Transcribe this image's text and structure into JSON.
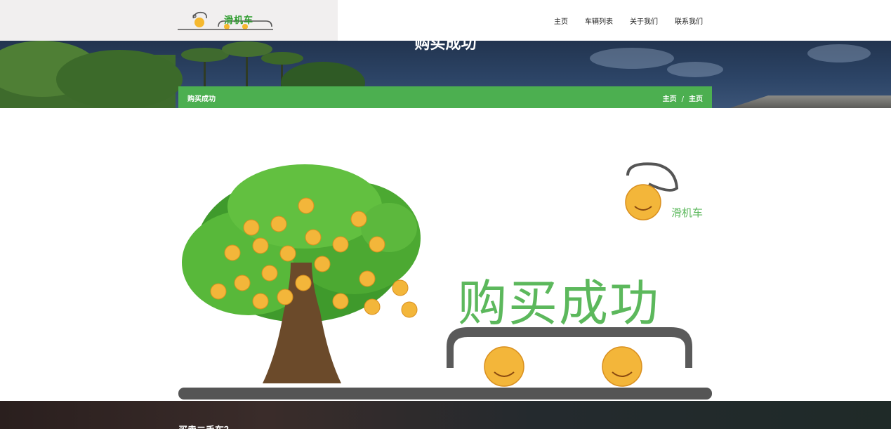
{
  "header": {
    "logo_text": "滑机车",
    "nav": [
      "主页",
      "车辆列表",
      "关于我们",
      "联系我们"
    ]
  },
  "banner": {
    "title": "购买成功"
  },
  "breadcrumb_bar": {
    "title": "购买成功",
    "crumbs": [
      "主页",
      "/",
      "主页"
    ]
  },
  "illustration": {
    "brand_text": "滑机车",
    "success_text": "购买成功",
    "accent_color": "#5cb85c"
  },
  "footer": {
    "title": "买卖二手车？"
  },
  "colors": {
    "primary_green": "#4caf50",
    "logo_bg": "#f1efef",
    "banner_sky": "#2c4466"
  }
}
